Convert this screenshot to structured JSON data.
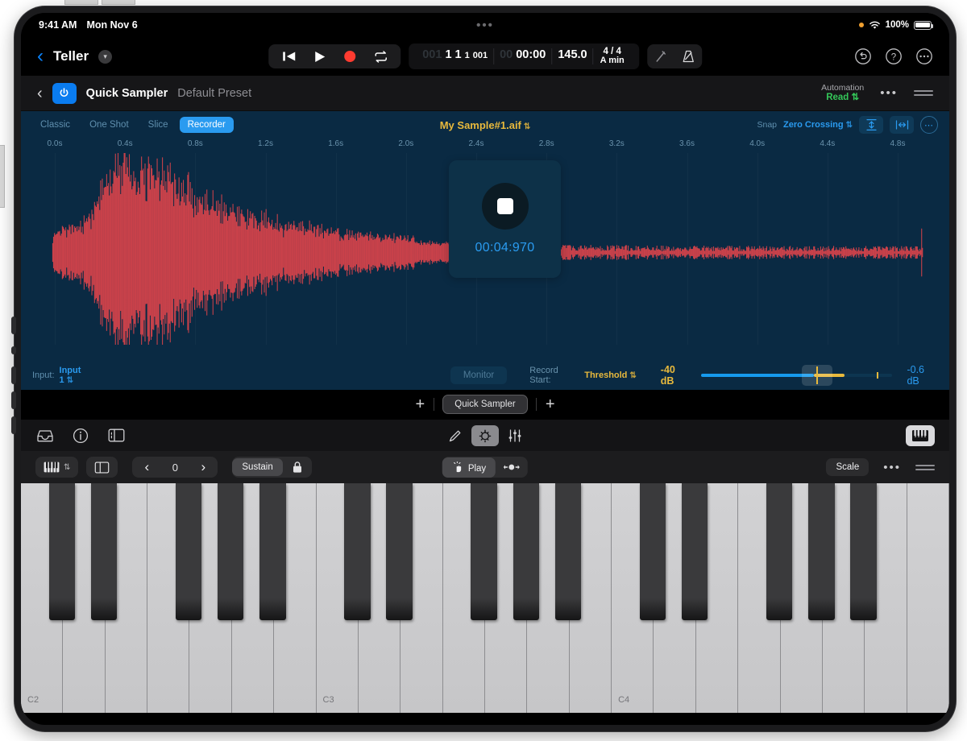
{
  "status_bar": {
    "time": "9:41 AM",
    "date": "Mon Nov 6",
    "battery_percent": "100%",
    "dots": "•••"
  },
  "toolbar": {
    "back_icon": "chevron-left-icon",
    "project_name": "Teller",
    "transport": {
      "rewind_icon": "rewind-to-start-icon",
      "play_icon": "play-icon",
      "record_icon": "record-icon",
      "cycle_icon": "cycle-loop-icon"
    },
    "lcd": {
      "bars_dim": "001",
      "bars": "1 1 1 001",
      "bars_b1": "1",
      "bars_b2": "1",
      "bars_b3": "1",
      "bars_ticks": "001",
      "time_dim": "00",
      "time": "00:00",
      "tempo": "145.0",
      "signature": "4 / 4",
      "key": "A min"
    },
    "tuner_icon": "tuning-fork-icon",
    "metronome_icon": "metronome-icon",
    "undo_icon": "undo-icon",
    "help_icon": "help-icon",
    "more_icon": "more-icon"
  },
  "plugin_header": {
    "back_icon": "chevron-left-icon",
    "power_icon": "power-icon",
    "title": "Quick Sampler",
    "preset": "Default Preset",
    "automation_label": "Automation",
    "automation_value": "Read",
    "more_label": "•••"
  },
  "sampler": {
    "modes": [
      {
        "label": "Classic",
        "active": false
      },
      {
        "label": "One Shot",
        "active": false
      },
      {
        "label": "Slice",
        "active": false
      },
      {
        "label": "Recorder",
        "active": true
      }
    ],
    "sample_name": "My Sample#1.aif",
    "snap_label": "Snap",
    "snap_value": "Zero Crossing",
    "vertical_zoom_icon": "vertical-fit-icon",
    "horizontal_zoom_icon": "horizontal-fit-icon",
    "options_icon": "more-circle-icon",
    "ruler": [
      "0.0s",
      "0.4s",
      "0.8s",
      "1.2s",
      "1.6s",
      "2.0s",
      "2.4s",
      "2.8s",
      "3.2s",
      "3.6s",
      "4.0s",
      "4.4s",
      "4.8s"
    ],
    "record_overlay": {
      "stop_icon": "stop-icon",
      "elapsed": "00:04:970"
    },
    "footer": {
      "input_label": "Input:",
      "input_value": "Input 1",
      "monitor_label": "Monitor",
      "record_start_label": "Record Start:",
      "record_start_value": "Threshold",
      "threshold_db": "-40 dB",
      "peak_db": "-0.6 dB"
    },
    "colors": {
      "panel_bg": "#0a2a43",
      "waveform": "#c8414a",
      "accent_blue": "#2a9bf0",
      "accent_yellow": "#e8b93c"
    }
  },
  "slot_row": {
    "add_left_label": "+",
    "slot_label": "Quick Sampler",
    "add_right_label": "+"
  },
  "icon_toolbar": {
    "library_icon": "library-icon",
    "info_icon": "info-icon",
    "panel_icon": "panel-layout-icon",
    "pencil_icon": "pencil-icon",
    "controls_icon": "smart-controls-icon",
    "mixer_icon": "faders-icon",
    "keyboard_icon": "keyboard-icon"
  },
  "keyboard_bar": {
    "keyboard_icon": "keyboard-icon",
    "layout_icon": "panel-layout-icon",
    "octave_prev_icon": "chevron-left-icon",
    "octave_value": "0",
    "octave_next_icon": "chevron-right-icon",
    "sustain_label": "Sustain",
    "lock_icon": "lock-icon",
    "play_label": "Play",
    "play_icon": "tap-hand-icon",
    "pitchbend_icon": "pitch-bend-icon",
    "scale_label": "Scale",
    "more_label": "•••",
    "resize_icon": "resize-handle-icon"
  },
  "piano": {
    "octave_labels": [
      "C2",
      "C3",
      "C4"
    ]
  }
}
